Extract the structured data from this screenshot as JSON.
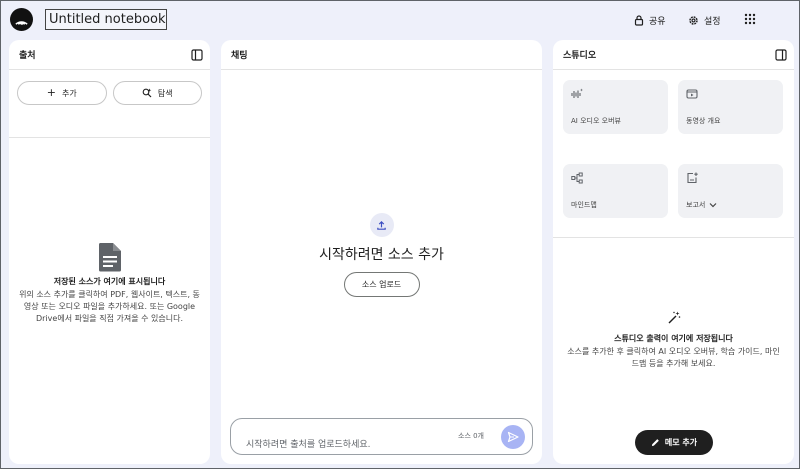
{
  "header": {
    "notebook_title": "Untitled notebook",
    "share_label": "공유",
    "settings_label": "설정"
  },
  "sources": {
    "title": "출처",
    "add_label": "추가",
    "explore_label": "탐색",
    "empty_title": "저장된 소스가 여기에 표시됩니다",
    "empty_desc": "위의 소스 추가를 클릭하여 PDF, 웹사이트, 텍스트, 동영상 또는 오디오 파일을 추가하세요. 또는 Google Drive에서 파일을 직접 가져올 수 있습니다."
  },
  "chat": {
    "title": "채팅",
    "empty_title": "시작하려면 소스 추가",
    "upload_label": "소스 업로드",
    "input_placeholder": "시작하려면 출처를 업로드하세요.",
    "source_count": "소스 0개"
  },
  "studio": {
    "title": "스튜디오",
    "cards": [
      {
        "label": "AI 오디오 오버뷰",
        "icon": "audio-waveform-icon"
      },
      {
        "label": "동영상 개요",
        "icon": "video-icon"
      },
      {
        "label": "마인드맵",
        "icon": "mindmap-icon"
      },
      {
        "label": "보고서",
        "icon": "report-icon"
      }
    ],
    "empty_title": "스튜디오 출력이 여기에 저장됩니다",
    "empty_desc": "소스를 추가한 후 클릭하여 AI 오디오 오버뷰, 학습 가이드, 마인드맵 등을 추가해 보세요.",
    "memo_label": "메모 추가"
  },
  "colors": {
    "background": "#eef0fa",
    "send_button": "#a8b4f4",
    "memo_button": "#1f1f1f"
  }
}
